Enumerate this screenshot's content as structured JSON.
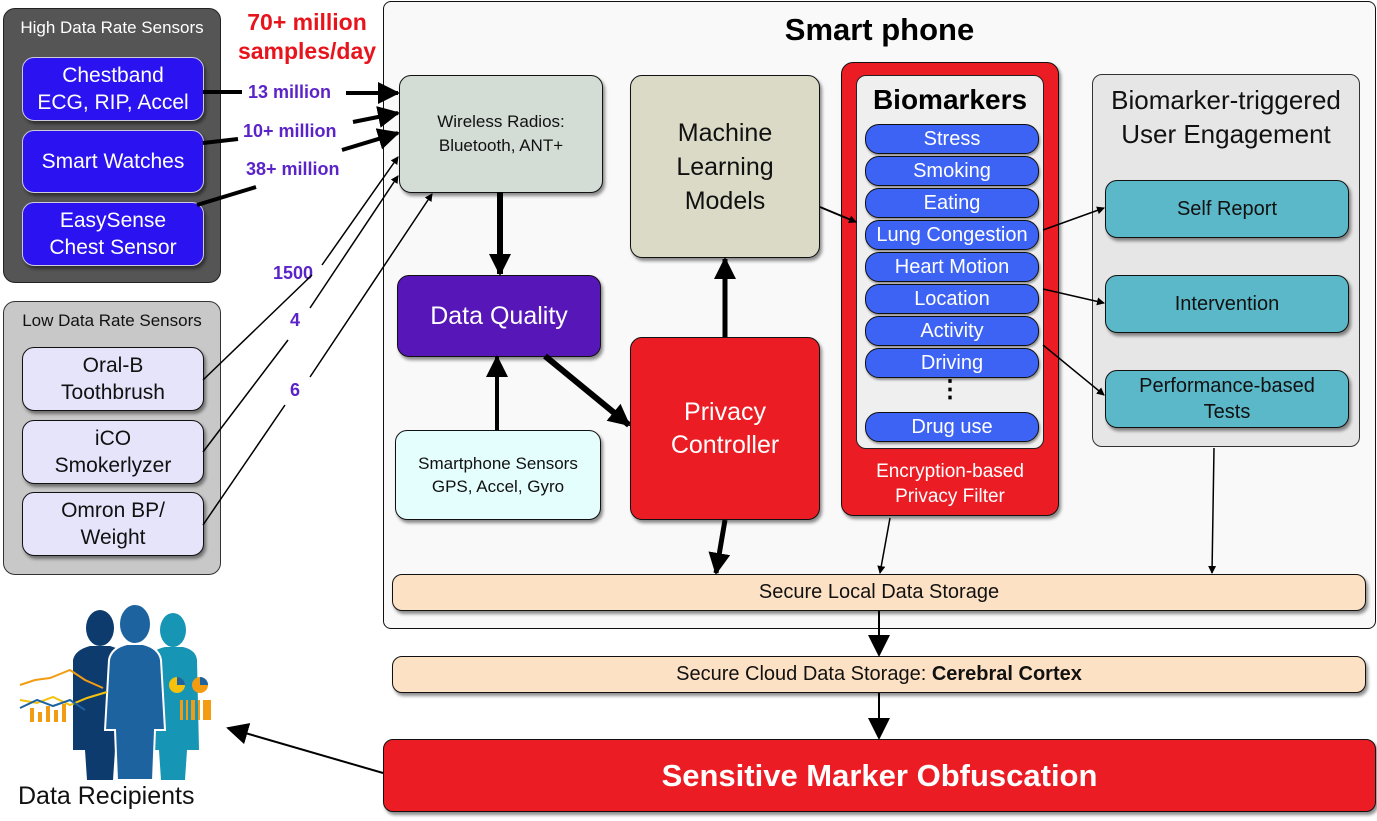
{
  "headline": {
    "line1": "70+ million",
    "line2": "samples/day",
    "color": "#e8141c"
  },
  "high_rate_group": {
    "title": "High Data Rate Sensors",
    "sensors": [
      {
        "line1": "Chestband",
        "line2": "ECG, RIP, Accel",
        "rate": "13 million"
      },
      {
        "line1": "Smart Watches",
        "line2": "",
        "rate": "10+ million"
      },
      {
        "line1": "EasySense",
        "line2": "Chest Sensor",
        "rate": "38+ million"
      }
    ]
  },
  "low_rate_group": {
    "title": "Low Data Rate Sensors",
    "sensors": [
      {
        "line1": "Oral-B",
        "line2": "Toothbrush",
        "rate": "1500"
      },
      {
        "line1": "iCO",
        "line2": "Smokerlyzer",
        "rate": "4"
      },
      {
        "line1": "Omron BP/",
        "line2": "Weight",
        "rate": "6"
      }
    ]
  },
  "smartphone": {
    "title": "Smart phone",
    "wireless": {
      "line1": "Wireless Radios:",
      "line2": "Bluetooth, ANT+"
    },
    "ml_models": {
      "line1": "Machine",
      "line2": "Learning",
      "line3": "Models"
    },
    "data_quality": "Data Quality",
    "phone_sensors": {
      "line1": "Smartphone Sensors",
      "line2": "GPS, Accel, Gyro"
    },
    "privacy_controller": {
      "line1": "Privacy",
      "line2": "Controller"
    },
    "biomarkers": {
      "title": "Biomarkers",
      "items": [
        "Stress",
        "Smoking",
        "Eating",
        "Lung Congestion",
        "Heart Motion",
        "Location",
        "Activity",
        "Driving",
        "Drug use"
      ],
      "ellipsis": "⋮",
      "filter_line1": "Encryption-based",
      "filter_line2": "Privacy Filter"
    },
    "engagement": {
      "title_line1": "Biomarker-triggered",
      "title_line2": "User Engagement",
      "items": [
        {
          "line1": "Self Report",
          "line2": ""
        },
        {
          "line1": "Intervention",
          "line2": ""
        },
        {
          "line1": "Performance-based",
          "line2": "Tests"
        }
      ]
    },
    "local_storage": "Secure Local Data Storage"
  },
  "cloud_storage": {
    "prefix": "Secure Cloud Data Storage: ",
    "name": "Cerebral Cortex"
  },
  "obfuscation": "Sensitive Marker Obfuscation",
  "recipients": {
    "label": "Data Recipients",
    "icon": "business-people-icon"
  },
  "colors": {
    "sensor_blue": "#2b12f0",
    "low_sensor_fill": "#e6e4fb",
    "data_quality": "#5717b8",
    "privacy_red": "#ec1c24",
    "biomarker_pill": "#3d63f5",
    "engagement_teal": "#5ab8c8",
    "storage_peach": "#fde1c4",
    "rate_purple": "#5b24c8"
  }
}
